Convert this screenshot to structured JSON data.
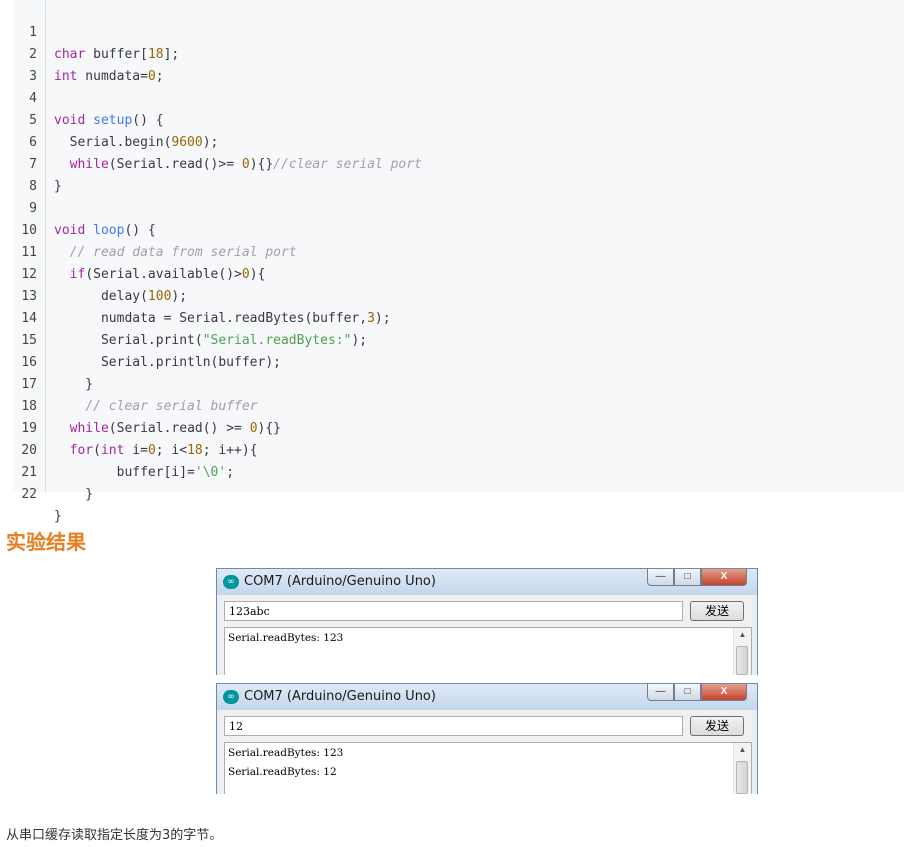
{
  "code": {
    "line_numbers": [
      "1",
      "2",
      "3",
      "4",
      "5",
      "6",
      "7",
      "8",
      "9",
      "10",
      "11",
      "12",
      "13",
      "14",
      "15",
      "16",
      "17",
      "18",
      "19",
      "20",
      "21",
      "22"
    ],
    "l1": [
      "char",
      " buffer[",
      "18",
      "];"
    ],
    "l2": [
      "int",
      " numdata=",
      "0",
      ";"
    ],
    "l4": [
      "void",
      " ",
      "setup",
      "() {"
    ],
    "l5": [
      "  Serial.begin(",
      "9600",
      ");"
    ],
    "l6": [
      "  ",
      "while",
      "(Serial.read()>= ",
      "0",
      "){}",
      "//clear serial port"
    ],
    "l7": "}",
    "l9": [
      "void",
      " ",
      "loop",
      "() {"
    ],
    "l10": [
      "  ",
      "// read data from serial port"
    ],
    "l11": [
      "  ",
      "if",
      "(Serial.available()>",
      "0",
      "){"
    ],
    "l12": [
      "      delay(",
      "100",
      ");"
    ],
    "l13": [
      "      numdata = Serial.readBytes(buffer,",
      "3",
      ");"
    ],
    "l14": [
      "      Serial.print(",
      "\"Serial.readBytes:\"",
      ");"
    ],
    "l15": "      Serial.println(buffer);",
    "l16": "    }",
    "l17": [
      "    ",
      "// clear serial buffer"
    ],
    "l18": [
      "  ",
      "while",
      "(Serial.read() >= ",
      "0",
      "){}"
    ],
    "l19": [
      "  ",
      "for",
      "(",
      "int",
      " i=",
      "0",
      "; i<",
      "18",
      "; i++){"
    ],
    "l20": [
      "        buffer[i]=",
      "'\\0'",
      ";"
    ],
    "l21": "    }",
    "l22": "}"
  },
  "heading": "实验结果",
  "windows": [
    {
      "title": "COM7 (Arduino/Genuino Uno)",
      "input_value": "123abc",
      "send_label": "发送",
      "output": [
        "Serial.readBytes: 123"
      ]
    },
    {
      "title": "COM7 (Arduino/Genuino Uno)",
      "input_value": "12",
      "send_label": "发送",
      "output": [
        "Serial.readBytes: 123",
        "Serial.readBytes: 12"
      ]
    }
  ],
  "icons": {
    "app": "arduino-icon",
    "minimize": "minimize-icon",
    "maximize": "maximize-icon",
    "close": "close-icon",
    "scroll_up": "scroll-up-arrow-icon"
  },
  "glyphs": {
    "app": "∞",
    "minimize": "—",
    "maximize": "□",
    "close": "X",
    "scroll_up": "▲"
  },
  "caption": "从串口缓存读取指定长度为3的字节。"
}
